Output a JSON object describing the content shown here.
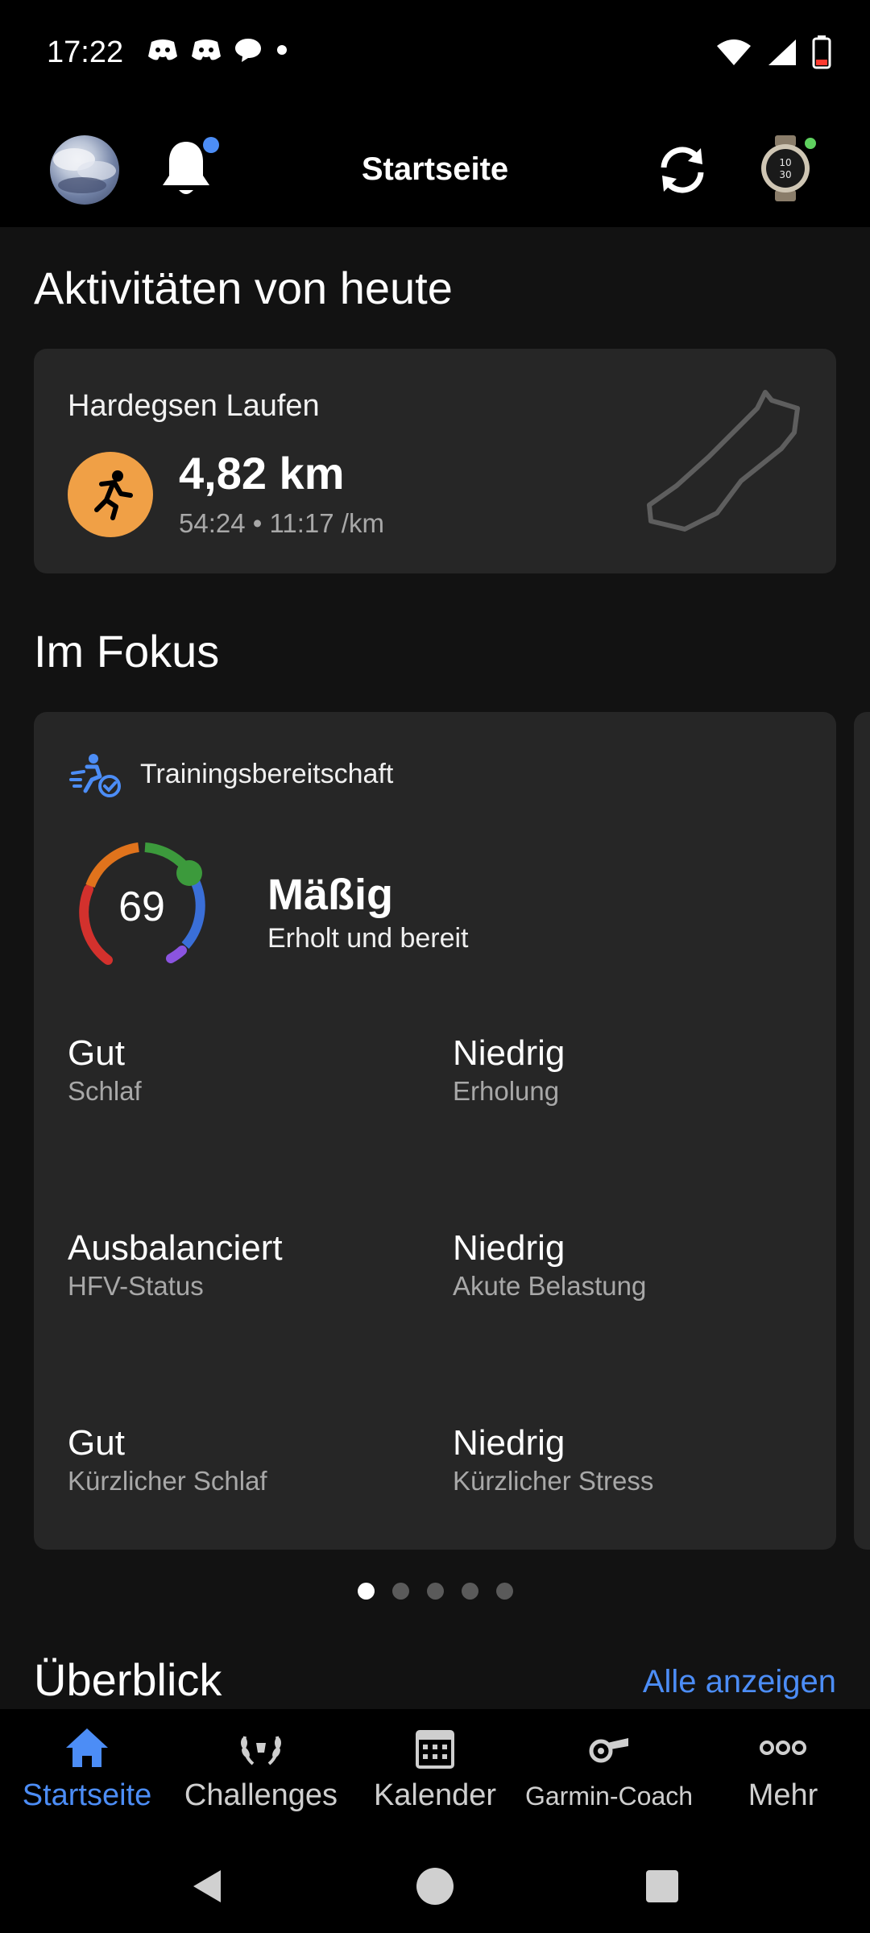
{
  "status_bar": {
    "time": "17:22"
  },
  "header": {
    "title": "Startseite"
  },
  "today": {
    "heading": "Aktivitäten von heute",
    "activity": {
      "name": "Hardegsen Laufen",
      "distance": "4,82 km",
      "meta": "54:24 • 11:17 /km",
      "icon_color": "#f0a046"
    }
  },
  "focus": {
    "heading": "Im Fokus",
    "card": {
      "title": "Trainingsbereitschaft",
      "score": "69",
      "level": "Mäßig",
      "description": "Erholt und bereit",
      "metrics": [
        {
          "value": "Gut",
          "label": "Schlaf"
        },
        {
          "value": "Niedrig",
          "label": "Erholung"
        },
        {
          "value": "Ausbalanciert",
          "label": "HFV-Status"
        },
        {
          "value": "Niedrig",
          "label": "Akute Belastung"
        },
        {
          "value": "Gut",
          "label": "Kürzlicher Schlaf"
        },
        {
          "value": "Niedrig",
          "label": "Kürzlicher Stress"
        }
      ]
    },
    "pager": {
      "count": 5,
      "active": 1
    }
  },
  "overview": {
    "heading": "Überblick",
    "see_all": "Alle anzeigen"
  },
  "bottom_nav": [
    {
      "label": "Startseite",
      "icon": "home-icon",
      "active": true
    },
    {
      "label": "Challenges",
      "icon": "laurel-icon",
      "active": false
    },
    {
      "label": "Kalender",
      "icon": "calendar-icon",
      "active": false
    },
    {
      "label": "Garmin-Coach",
      "icon": "whistle-icon",
      "active": false
    },
    {
      "label": "Mehr",
      "icon": "more-icon",
      "active": false
    }
  ],
  "colors": {
    "accent": "#4c8df6",
    "background": "#121212",
    "card": "#262626"
  }
}
